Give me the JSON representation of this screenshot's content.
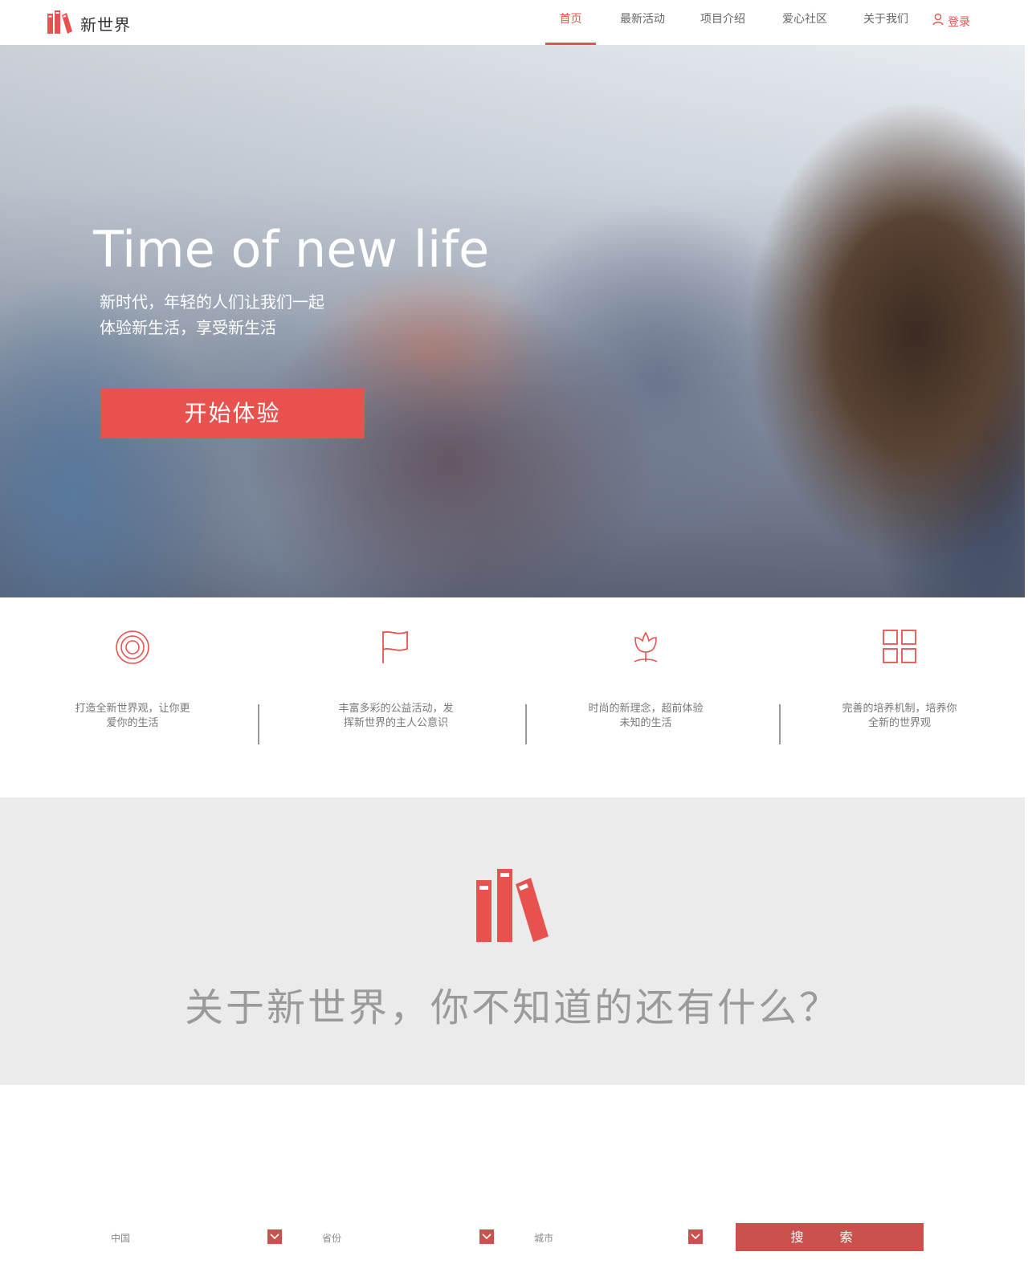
{
  "header": {
    "logo_text": "新世界",
    "nav": [
      {
        "label": "首页",
        "active": true
      },
      {
        "label": "最新活动",
        "active": false
      },
      {
        "label": "项目介绍",
        "active": false
      },
      {
        "label": "爱心社区",
        "active": false
      },
      {
        "label": "关于我们",
        "active": false
      }
    ],
    "login_label": "登录"
  },
  "hero": {
    "title": "Time of new life",
    "subtitle_line1": "新时代，年轻的人们让我们一起",
    "subtitle_line2": "体验新生活，享受新生活",
    "cta_label": "开始体验"
  },
  "features": [
    {
      "icon": "target-icon",
      "line1": "打造全新世界观，让你更",
      "line2": "爱你的生活"
    },
    {
      "icon": "flag-icon",
      "line1": "丰富多彩的公益活动，发",
      "line2": "挥新世界的主人公意识"
    },
    {
      "icon": "tulip-icon",
      "line1": "时尚的新理念，超前体验",
      "line2": "未知的生活"
    },
    {
      "icon": "grid-icon",
      "line1": "完善的培养机制，培养你",
      "line2": "全新的世界观"
    }
  ],
  "about": {
    "icon": "books-icon",
    "title": "关于新世界，你不知道的还有什么？"
  },
  "search": {
    "country_label": "中国",
    "province_label": "省份",
    "city_label": "城市",
    "button_label": "搜 索"
  },
  "colors": {
    "accent": "#e8524e",
    "search_accent": "#c9524e",
    "about_bg": "#ebebeb"
  }
}
